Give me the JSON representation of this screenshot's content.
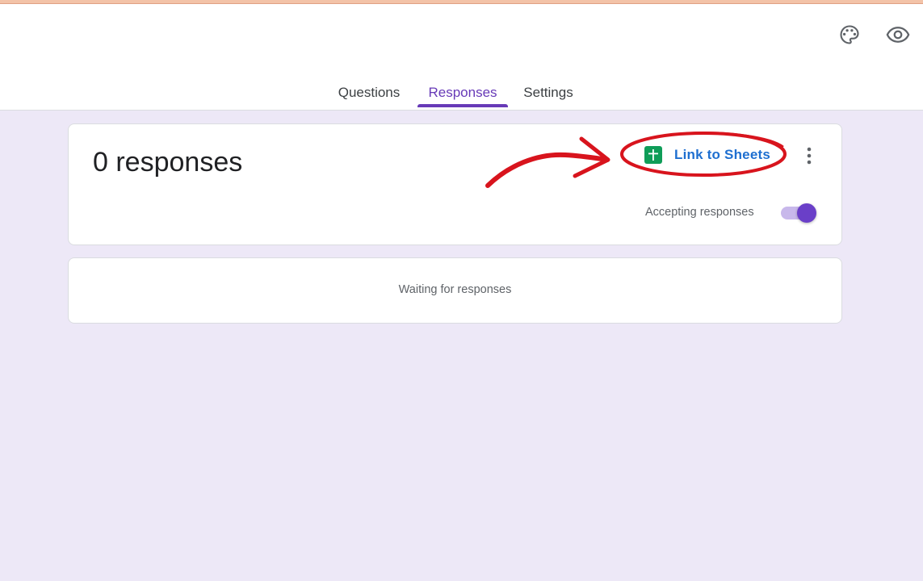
{
  "header": {
    "palette_icon": "palette-icon",
    "preview_icon": "eye-icon",
    "tabs": [
      {
        "label": "Questions",
        "active": false
      },
      {
        "label": "Responses",
        "active": true
      },
      {
        "label": "Settings",
        "active": false
      }
    ]
  },
  "summary": {
    "count_text": "0 responses",
    "link_sheets_label": "Link to Sheets",
    "sheets_icon": "google-sheets-icon",
    "more_icon": "more-vert-icon",
    "accepting_label": "Accepting responses",
    "accepting_on": true
  },
  "waiting": {
    "text": "Waiting for responses"
  },
  "colors": {
    "accent": "#673ab7",
    "background": "#ede8f7",
    "link": "#1e6fd0",
    "sheets_green": "#0f9d58",
    "annotation_red": "#d8141d"
  }
}
